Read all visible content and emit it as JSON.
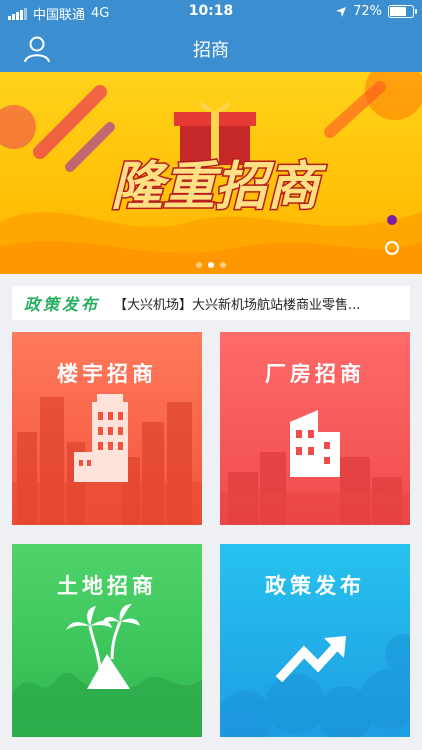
{
  "status_bar": {
    "carrier": "中国联通",
    "network": "4G",
    "time": "10:18",
    "battery": "72%",
    "battery_level": 0.72
  },
  "navbar": {
    "title": "招商",
    "user_icon": "user-icon"
  },
  "banner": {
    "headline": "隆重招商",
    "slides": 3,
    "active_slide": 1
  },
  "notice": {
    "label": "政策发布",
    "text": "【大兴机场】大兴新机场航站楼商业零售..."
  },
  "tiles": [
    {
      "label": "楼宇招商",
      "icon": "building-icon",
      "color": "#f2533d"
    },
    {
      "label": "厂房招商",
      "icon": "factory-icon",
      "color": "#f04b4b"
    },
    {
      "label": "土地招商",
      "icon": "land-palm-icon",
      "color": "#2fb84f"
    },
    {
      "label": "政策发布",
      "icon": "trend-arrow-icon",
      "color": "#1e9de2"
    }
  ]
}
